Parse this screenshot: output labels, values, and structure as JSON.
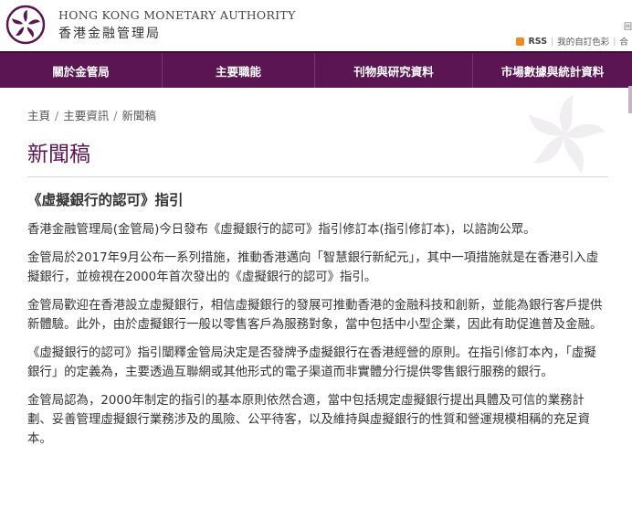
{
  "header": {
    "org_name_en": "HONG KONG MONETARY AUTHORITY",
    "org_name_zh": "香港金融管理局",
    "rss_label": "RSS",
    "separator": "|",
    "custom_colour_label": "我的自訂色彩",
    "cut_label": "回",
    "cut_label2": "合"
  },
  "nav": {
    "items": [
      "關於金管局",
      "主要職能",
      "刊物與研究資料",
      "市場數據與統計資料"
    ]
  },
  "breadcrumb": [
    "主頁",
    "主要資訊",
    "新聞稿"
  ],
  "breadcrumb_sep": "/",
  "page_title": "新聞稿",
  "article": {
    "title": "《虛擬銀行的認可》指引",
    "paragraphs": [
      "香港金融管理局(金管局)今日發布《虛擬銀行的認可》指引修訂本(指引修訂本)，以諮詢公眾。",
      "金管局於2017年9月公布一系列措施，推動香港邁向「智慧銀行新紀元」，其中一項措施就是在香港引入虛擬銀行，並檢視在2000年首次發出的《虛擬銀行的認可》指引。",
      "金管局歡迎在香港設立虛擬銀行，相信虛擬銀行的發展可推動香港的金融科技和創新，並能為銀行客戶提供新體驗。此外，由於虛擬銀行一般以零售客戶為服務對象，當中包括中小型企業，因此有助促進普及金融。",
      "《虛擬銀行的認可》指引闡釋金管局決定是否發牌予虛擬銀行在香港經營的原則。在指引修訂本內，「虛擬銀行」的定義為，主要透過互聯網或其他形式的電子渠道而非實體分行提供零售銀行服務的銀行。",
      "金管局認為，2000年制定的指引的基本原則依然合適，當中包括規定虛擬銀行提出具體及可信的業務計劃、妥善管理虛擬銀行業務涉及的風險、公平待客，以及維持與虛擬銀行的性質和營運規模相稱的充足資本。"
    ]
  },
  "colors": {
    "brand_purple": "#5b1553",
    "rss_orange": "#f08a24"
  }
}
